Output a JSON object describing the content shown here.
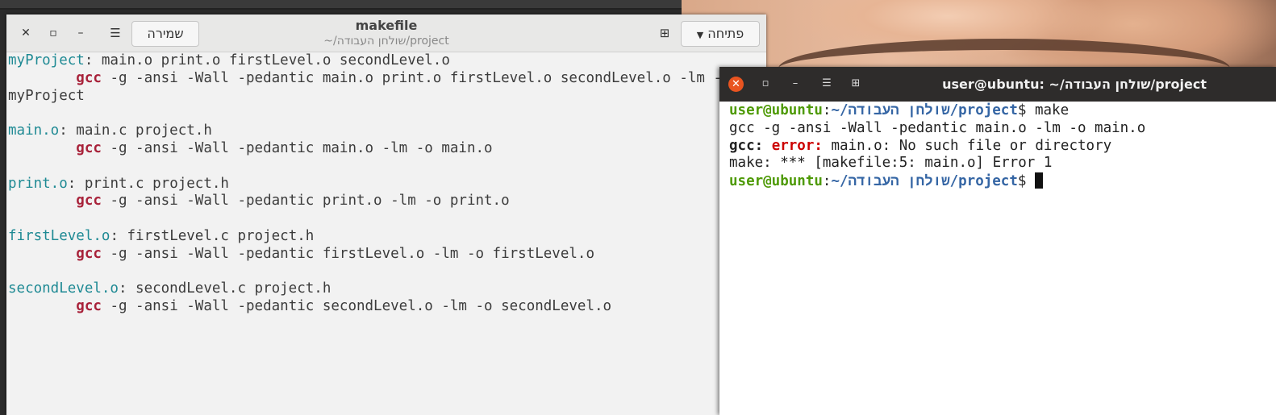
{
  "editor": {
    "title": "makefile",
    "subtitle": "~/שולחן העבודה/project",
    "save_label": "שמירה",
    "open_label": "פתיחה",
    "menu_icon": "hamburger-icon",
    "new_tab_icon": "new-tab-icon",
    "lines": [
      {
        "target": "myProject",
        "rest": ": main.o print.o firstLevel.o secondLevel.o"
      },
      {
        "indent": "        ",
        "kw": "gcc",
        "rest": " -g -ansi -Wall -pedantic main.o print.o firstLevel.o secondLevel.o -lm -o"
      },
      {
        "rest": "myProject"
      },
      {
        "rest": ""
      },
      {
        "target": "main.o",
        "rest": ": main.c project.h"
      },
      {
        "indent": "        ",
        "kw": "gcc",
        "rest": " -g -ansi -Wall -pedantic main.o -lm -o main.o"
      },
      {
        "rest": ""
      },
      {
        "target": "print.o",
        "rest": ": print.c project.h"
      },
      {
        "indent": "        ",
        "kw": "gcc",
        "rest": " -g -ansi -Wall -pedantic print.o -lm -o print.o"
      },
      {
        "rest": ""
      },
      {
        "target": "firstLevel.o",
        "rest": ": firstLevel.c project.h"
      },
      {
        "indent": "        ",
        "kw": "gcc",
        "rest": " -g -ansi -Wall -pedantic firstLevel.o -lm -o firstLevel.o"
      },
      {
        "rest": ""
      },
      {
        "target": "secondLevel.o",
        "rest": ": secondLevel.c project.h"
      },
      {
        "indent": "        ",
        "kw": "gcc",
        "rest": " -g -ansi -Wall -pedantic secondLevel.o -lm -o secondLevel.o"
      }
    ]
  },
  "terminal": {
    "title": "user@ubuntu: ~/שולחן העבודה/project",
    "prompt_user": "user@ubuntu",
    "prompt_colon": ":",
    "prompt_path": "~/שולחן העבודה/project",
    "prompt_symbol": "$ ",
    "command": "make",
    "out1": "gcc -g -ansi -Wall -pedantic main.o -lm -o main.o",
    "err_prog": "gcc:",
    "err_word": " error:",
    "err_msg": " main.o: No such file or directory",
    "out3": "make: *** [makefile:5: main.o] Error 1",
    "colors": {
      "user": "#4e9a06",
      "path": "#3465a4",
      "error": "#cc0000",
      "close": "#e95420"
    }
  }
}
